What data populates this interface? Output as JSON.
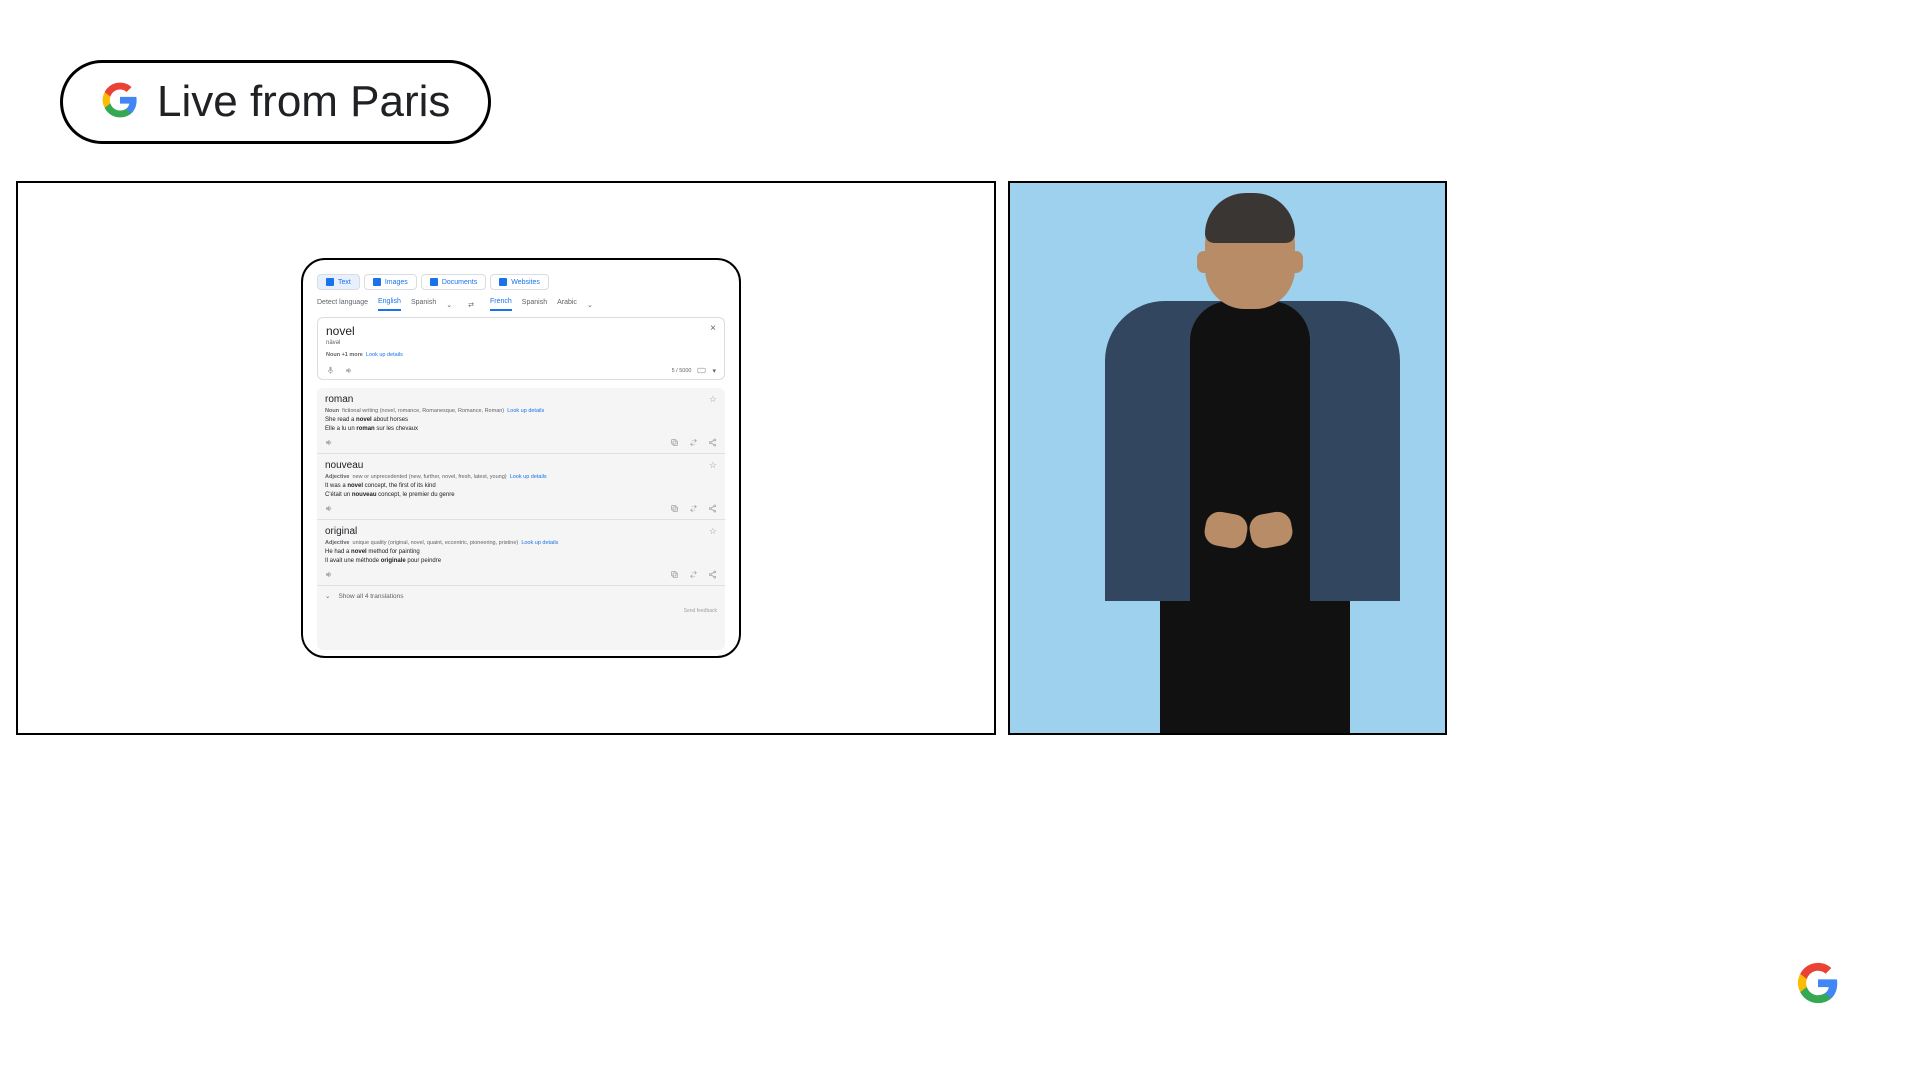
{
  "badge": {
    "label": "Live from Paris"
  },
  "modes": [
    {
      "label": "Text",
      "active": true
    },
    {
      "label": "Images",
      "active": false
    },
    {
      "label": "Documents",
      "active": false
    },
    {
      "label": "Websites",
      "active": false
    }
  ],
  "source_langs": {
    "detect": "Detect language",
    "items": [
      "English",
      "Spanish"
    ],
    "selected": "English"
  },
  "target_langs": {
    "items": [
      "French",
      "Spanish",
      "Arabic"
    ],
    "selected": "French"
  },
  "input": {
    "word": "novel",
    "phonetic": "nävəl",
    "pos_summary": "Noun +1 more",
    "lookup": "Look up details",
    "char_count": "5 / 5000"
  },
  "results": [
    {
      "title": "roman",
      "pos": "Noun",
      "gloss": "fictional writing (novel, romance, Romanesque, Romance, Roman)",
      "lookup": "Look up details",
      "ex_en_pre": "She read a ",
      "ex_en_b": "novel",
      "ex_en_post": " about horses",
      "ex_fr_pre": "Elle a lu un ",
      "ex_fr_b": "roman",
      "ex_fr_post": " sur les chevaux"
    },
    {
      "title": "nouveau",
      "pos": "Adjective",
      "gloss": "new or unprecedented (new, further, novel, fresh, latest, young)",
      "lookup": "Look up details",
      "ex_en_pre": "It was a ",
      "ex_en_b": "novel",
      "ex_en_post": " concept, the first of its kind",
      "ex_fr_pre": "C'était un ",
      "ex_fr_b": "nouveau",
      "ex_fr_post": " concept, le premier du genre"
    },
    {
      "title": "original",
      "pos": "Adjective",
      "gloss": "unique quality (original, novel, quaint, eccentric, pioneering, pristine)",
      "lookup": "Look up details",
      "ex_en_pre": "He had a ",
      "ex_en_b": "novel",
      "ex_en_post": " method for painting",
      "ex_fr_pre": "Il avait une méthode ",
      "ex_fr_b": "originale",
      "ex_fr_post": " pour peindre"
    }
  ],
  "show_all": "Show all 4 translations",
  "feedback": "Send feedback"
}
